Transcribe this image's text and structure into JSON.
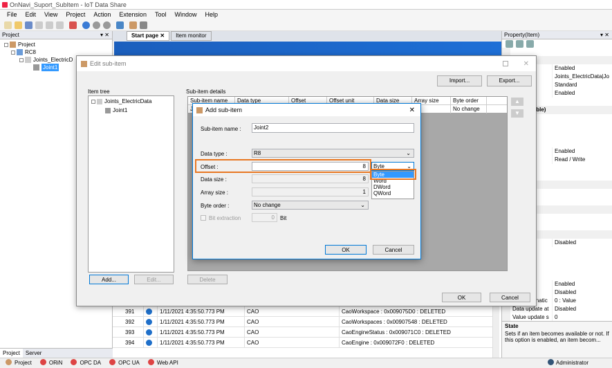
{
  "app_title": "OnNavi_Suport_SubItem - IoT Data Share",
  "menu": [
    "File",
    "Edit",
    "View",
    "Project",
    "Action",
    "Extension",
    "Tool",
    "Window",
    "Help"
  ],
  "project_panel": {
    "title": "Project",
    "pin": "▾ ✕",
    "tree": [
      "Project",
      "RC8",
      "Joints_ElectricD",
      "Joint1"
    ]
  },
  "tabs": {
    "start": "Start page",
    "monitor": "Item monitor"
  },
  "property_panel": {
    "title": "Property(Item)",
    "rows": [
      {
        "k": "",
        "v": ""
      },
      {
        "k": "Common",
        "v": "",
        "hdr": true
      },
      {
        "k": "",
        "v": "Enabled"
      },
      {
        "k": "ame",
        "v": "Joints_ElectricData|Jo"
      },
      {
        "k": "s",
        "v": "Standard"
      },
      {
        "k": "node",
        "v": "Enabled"
      },
      {
        "k": "",
        "v": ""
      },
      {
        "k": "CaoVariable)",
        "v": "",
        "hdr": true
      },
      {
        "k": "name",
        "v": ""
      },
      {
        "k": "",
        "v": ""
      },
      {
        "k": "bject",
        "v": ""
      },
      {
        "k": "",
        "v": ""
      },
      {
        "k": "g targ",
        "v": "Enabled"
      },
      {
        "k": "mode",
        "v": "Read / Write"
      },
      {
        "k": "stinatic",
        "v": ""
      },
      {
        "k": "ttings",
        "v": ""
      },
      {
        "k": "n",
        "v": "",
        "hdr": true
      },
      {
        "k": "settin",
        "v": ""
      },
      {
        "k": "ings",
        "v": ""
      },
      {
        "k": "er",
        "v": "",
        "hdr": true
      },
      {
        "k": "n ban",
        "v": ""
      },
      {
        "k": "ging che",
        "v": ""
      },
      {
        "k": "nversion",
        "v": "",
        "hdr": true
      },
      {
        "k": "",
        "v": "Disabled"
      },
      {
        "k": "eration",
        "v": ""
      },
      {
        "k": "versic",
        "v": ""
      },
      {
        "k": "versic",
        "v": ""
      },
      {
        "k": "",
        "v": ""
      },
      {
        "k": "ement",
        "v": "Enabled"
      },
      {
        "k": "rement",
        "v": "Disabled"
      },
      {
        "k": "Link destinatic",
        "v": "0 : Value"
      },
      {
        "k": "Data update at",
        "v": "Disabled"
      },
      {
        "k": "Value update s",
        "v": "0"
      }
    ],
    "state_title": "State",
    "state_desc": "Sets if an item becomes available or not. If this option is enabled, an item becom..."
  },
  "log_rows": [
    {
      "id": "391",
      "time": "1/11/2021 4:35:50.773 PM",
      "src": "CAO",
      "msg": "CaoWorkspace : 0x009075D0 : DELETED"
    },
    {
      "id": "392",
      "time": "1/11/2021 4:35:50.773 PM",
      "src": "CAO",
      "msg": "CaoWorkspaces : 0x00907548 : DELETED"
    },
    {
      "id": "393",
      "time": "1/11/2021 4:35:50.773 PM",
      "src": "CAO",
      "msg": "CaoEngineStatus : 0x009071C0 : DELETED"
    },
    {
      "id": "394",
      "time": "1/11/2021 4:35:50.773 PM",
      "src": "CAO",
      "msg": "CaoEngine : 0x009072F0 : DELETED"
    }
  ],
  "bottom_tabs": {
    "project": "Project",
    "server": "Server"
  },
  "status": {
    "items": [
      "Project",
      "ORiN",
      "OPC DA",
      "OPC UA",
      "Web API"
    ],
    "user": "Administrator"
  },
  "edit_dialog": {
    "title": "Edit sub-item",
    "import": "Import...",
    "export": "Export...",
    "item_tree_label": "Item tree",
    "tree": [
      "Joints_ElectricData",
      "Joint1"
    ],
    "details_label": "Sub-item details",
    "columns": [
      "Sub-item name",
      "Data type",
      "Offset",
      "Offset unit",
      "Data size",
      "Array size",
      "Byte order"
    ],
    "row": {
      "name": "Jo",
      "array": "1",
      "order": "No change"
    },
    "add": "Add...",
    "edit": "Edit...",
    "delete": "Delete",
    "ok": "OK",
    "cancel": "Cancel"
  },
  "add_dialog": {
    "title": "Add sub-item",
    "name_label": "Sub-item name :",
    "name_value": "Joint2",
    "type_label": "Data type :",
    "type_value": "R8",
    "offset_label": "Offset :",
    "offset_value": "8",
    "offset_unit": "Byte",
    "unit_options": [
      "Byte",
      "Word",
      "DWord",
      "QWord"
    ],
    "size_label": "Data size :",
    "size_value": "8",
    "array_label": "Array size :",
    "array_value": "1",
    "order_label": "Byte order :",
    "order_value": "No change",
    "bit_label": "Bit extraction",
    "bit_value": "0",
    "bit_unit": "Bit",
    "ok": "OK",
    "cancel": "Cancel"
  },
  "colors": {
    "highlight": "#e87722",
    "select": "#3399ff",
    "accent": "#0078d7"
  }
}
